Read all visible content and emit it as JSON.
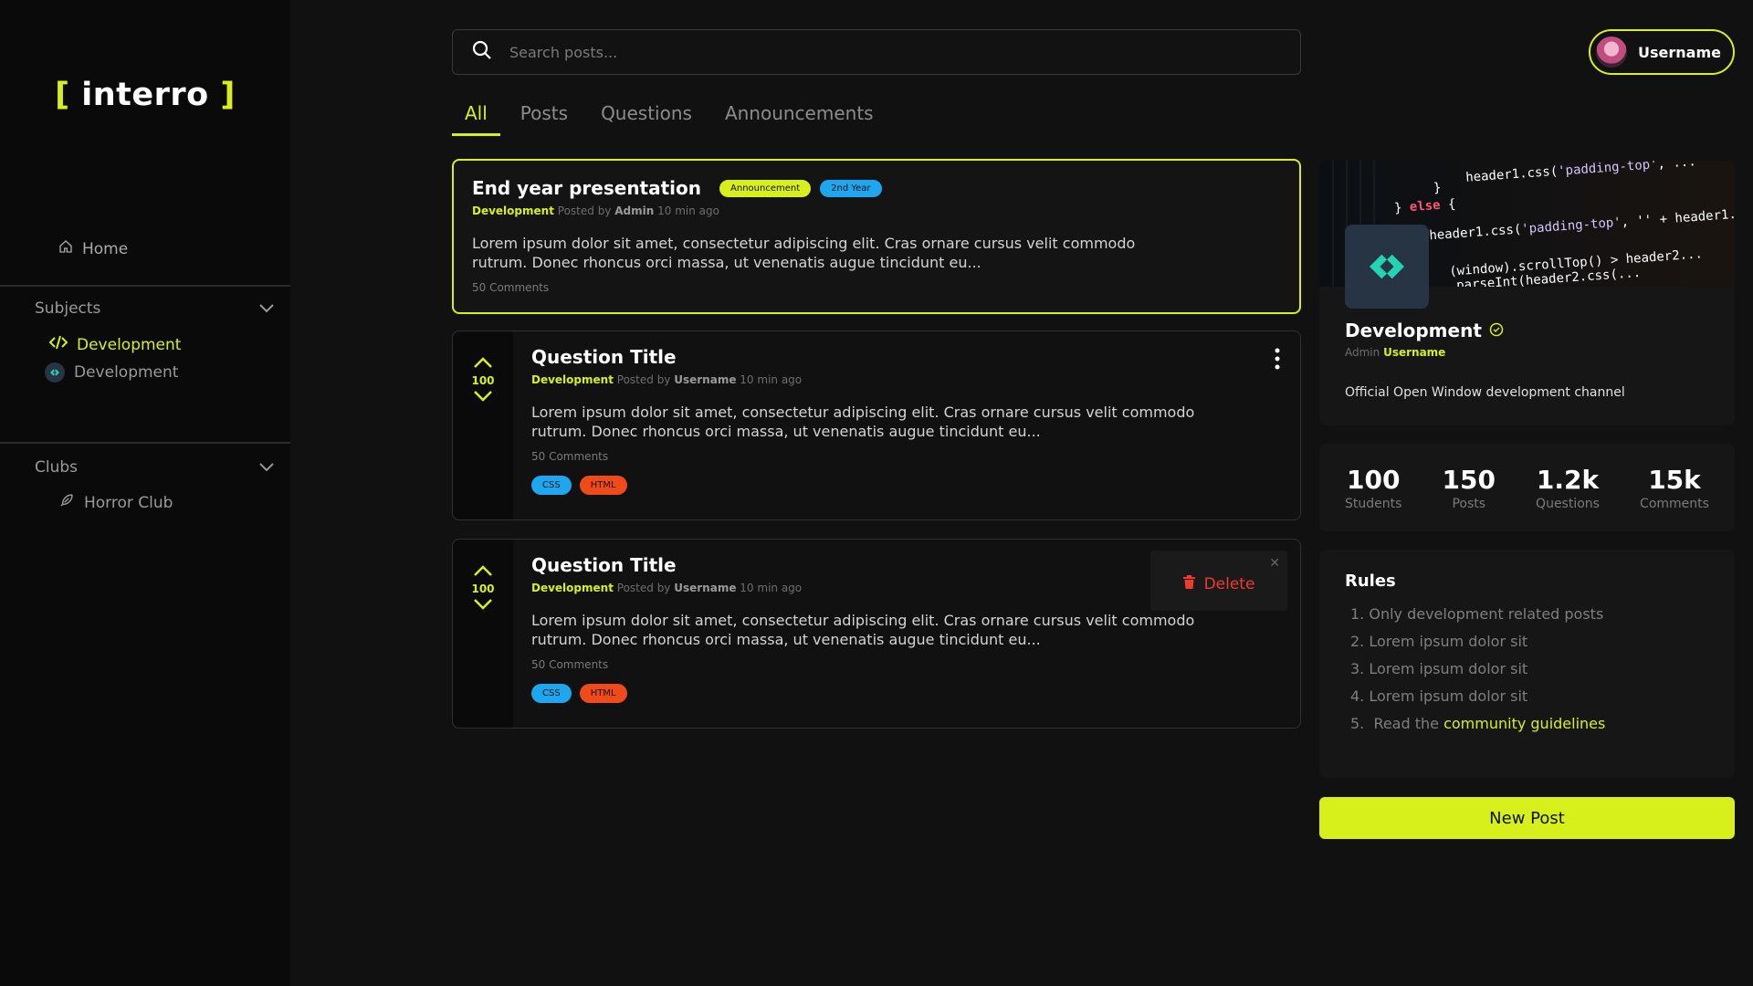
{
  "brand": {
    "open": "[",
    "name": "interro",
    "close": "]",
    "accent": "#d7f01c"
  },
  "sidebar": {
    "home_label": "Home",
    "subjects_label": "Subjects",
    "subjects": [
      {
        "label": "Development",
        "icon": "code-icon",
        "active": true
      },
      {
        "label": "Development",
        "icon": "channel-logo-icon",
        "active": false
      }
    ],
    "clubs_label": "Clubs",
    "clubs": [
      {
        "label": "Horror Club",
        "icon": "feather-icon"
      }
    ]
  },
  "search": {
    "placeholder": "Search posts..."
  },
  "user": {
    "name": "Username"
  },
  "tabs": [
    {
      "label": "All",
      "active": true
    },
    {
      "label": "Posts",
      "active": false
    },
    {
      "label": "Questions",
      "active": false
    },
    {
      "label": "Announcements",
      "active": false
    }
  ],
  "posts": [
    {
      "title": "End year presentation",
      "badges": [
        "Announcement",
        "2nd Year"
      ],
      "channel": "Development",
      "posted_by_prefix": "Posted by",
      "author": "Admin",
      "time": "10 min ago",
      "body_line1": "Lorem ipsum dolor sit amet, consectetur adipiscing elit. Cras ornare cursus velit commodo",
      "body_line2": "rutrum. Donec rhoncus orci massa, ut venenatis augue tincidunt eu...",
      "comments": "50 Comments"
    },
    {
      "title": "Question Title",
      "votes": "100",
      "channel": "Development",
      "posted_by_prefix": "Posted by",
      "author": "Username",
      "time": "10 min ago",
      "body_line1": "Lorem ipsum dolor sit amet, consectetur adipiscing elit. Cras ornare cursus velit commodo",
      "body_line2": "rutrum. Donec rhoncus orci massa, ut venenatis augue tincidunt eu...",
      "comments": "50 Comments",
      "tags": [
        "CSS",
        "HTML"
      ]
    },
    {
      "title": "Question Title",
      "votes": "100",
      "channel": "Development",
      "posted_by_prefix": "Posted by",
      "author": "Username",
      "time": "10 min ago",
      "body_line1": "Lorem ipsum dolor sit amet, consectetur adipiscing elit. Cras ornare cursus velit commodo",
      "body_line2": "rutrum. Donec rhoncus orci massa, ut venenatis augue tincidunt eu...",
      "comments": "50 Comments",
      "tags": [
        "CSS",
        "HTML"
      ],
      "menu_action": "Delete"
    }
  ],
  "channel": {
    "name": "Development",
    "admin_prefix": "Admin",
    "admin": "Username",
    "description": "Official Open Window development channel"
  },
  "stats": [
    {
      "value": "100",
      "label": "Students"
    },
    {
      "value": "150",
      "label": "Posts"
    },
    {
      "value": "1.2k",
      "label": "Questions"
    },
    {
      "value": "15k",
      "label": "Comments"
    }
  ],
  "rules": {
    "title": "Rules",
    "items": [
      "1.  Only development related posts",
      "2.  Lorem ipsum dolor sit",
      "3.  Lorem ipsum dolor sit",
      "4.  Lorem ipsum dolor sit"
    ],
    "last_prefix": "5.  Read the ",
    "last_link": "community guidelines"
  },
  "new_post_label": "New Post",
  "colors": {
    "accent": "#d7f01c",
    "css_tag": "#1ea6ee",
    "html_tag": "#f04a1a",
    "delete": "#ef3b2d",
    "badge_blue": "#1ea6ee"
  }
}
